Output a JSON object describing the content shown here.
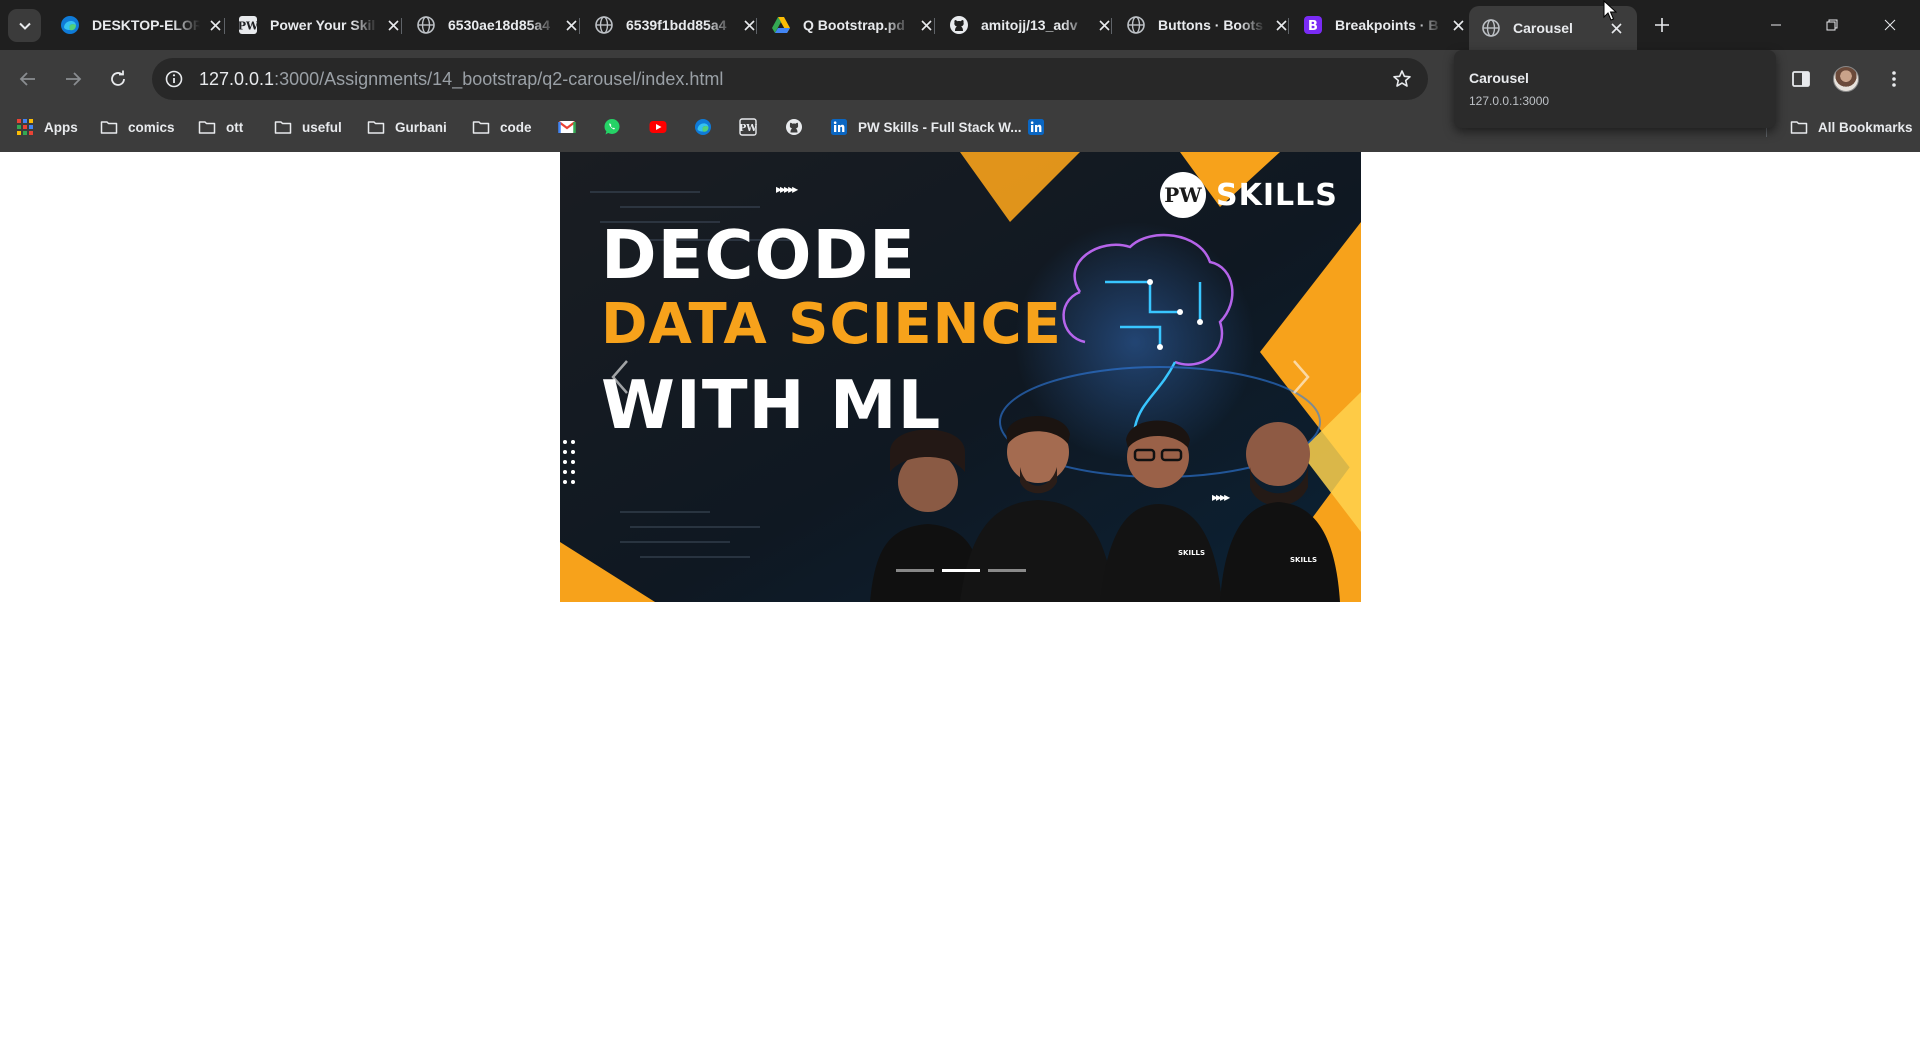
{
  "browser": {
    "tabs": [
      {
        "title": "DESKTOP-ELOR",
        "icon": "edge-icon"
      },
      {
        "title": "Power Your Skil",
        "icon": "pw-icon"
      },
      {
        "title": "6530ae18d85a4",
        "icon": "globe-icon"
      },
      {
        "title": "6539f1bdd85a4",
        "icon": "globe-icon"
      },
      {
        "title": "Q Bootstrap.pd",
        "icon": "drive-icon"
      },
      {
        "title": "amitojj/13_adv",
        "icon": "github-icon"
      },
      {
        "title": "Buttons · Boots",
        "icon": "globe-icon"
      },
      {
        "title": "Breakpoints · B",
        "icon": "bootstrap-icon"
      },
      {
        "title": "Carousel",
        "icon": "globe-icon",
        "active": true
      }
    ],
    "url": {
      "host": "127.0.0.1",
      "rest": ":3000/Assignments/14_bootstrap/q2-carousel/index.html"
    },
    "hovercard": {
      "title": "Carousel",
      "url": "127.0.0.1:3000"
    },
    "bookmarks": {
      "apps": "Apps",
      "comics": "comics",
      "ott": "ott",
      "useful": "useful",
      "gurbani": "Gurbani",
      "code": "code",
      "pw": "PW Skills - Full Stack W...",
      "all": "All Bookmarks"
    }
  },
  "carousel": {
    "slide": {
      "line1": "DECODE",
      "line2": "DATA SCIENCE",
      "line3": "WITH ML",
      "brand_logo": "PW",
      "brand_text": "SKILLS"
    },
    "indicator_count": 3,
    "active_index": 1
  },
  "colors": {
    "chrome_dark": "#1f1f1f",
    "chrome_toolbar": "#3c3c3c",
    "slide_accent": "#f7a21b"
  }
}
